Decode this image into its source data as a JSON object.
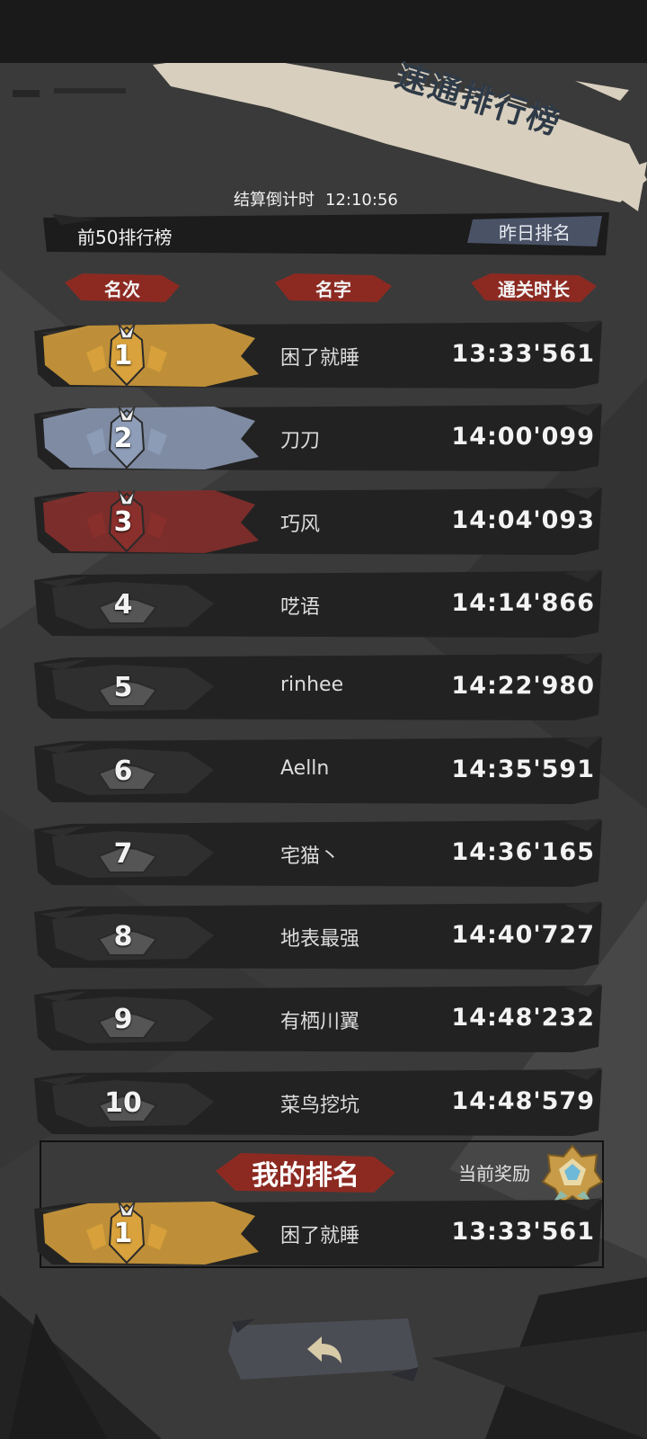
{
  "title": "速通排行榜",
  "countdown": {
    "label": "结算倒计时",
    "time": "12:10:56"
  },
  "leaderboard_label": "前50排行榜",
  "yesterday_button": "昨日排名",
  "columns": {
    "rank": "名次",
    "name": "名字",
    "time": "通关时长"
  },
  "rows": [
    {
      "rank": "1",
      "name": "困了就睡",
      "time": "13:33'561",
      "medal": "gold"
    },
    {
      "rank": "2",
      "name": "刀刀",
      "time": "14:00'099",
      "medal": "silver"
    },
    {
      "rank": "3",
      "name": "巧风",
      "time": "14:04'093",
      "medal": "bronze"
    },
    {
      "rank": "4",
      "name": "呓语",
      "time": "14:14'866",
      "medal": "none"
    },
    {
      "rank": "5",
      "name": "rinhee",
      "time": "14:22'980",
      "medal": "none"
    },
    {
      "rank": "6",
      "name": "Aelln",
      "time": "14:35'591",
      "medal": "none"
    },
    {
      "rank": "7",
      "name": "宅猫丶",
      "time": "14:36'165",
      "medal": "none"
    },
    {
      "rank": "8",
      "name": "地表最强",
      "time": "14:40'727",
      "medal": "none"
    },
    {
      "rank": "9",
      "name": "有栖川翼",
      "time": "14:48'232",
      "medal": "none"
    },
    {
      "rank": "10",
      "name": "菜鸟挖坑",
      "time": "14:48'579",
      "medal": "none"
    }
  ],
  "my_rank": {
    "title": "我的排名",
    "reward_label": "当前奖励",
    "reward_icon": "gold-crest-icon",
    "rank": "1",
    "name": "困了就睡",
    "time": "13:33'561",
    "medal": "gold"
  },
  "back_icon": "back-arrow-icon",
  "colors": {
    "gold": "#d9a23c",
    "silver": "#8e9db8",
    "bronze": "#8a2f2b",
    "header_red": "#8c2a22"
  }
}
